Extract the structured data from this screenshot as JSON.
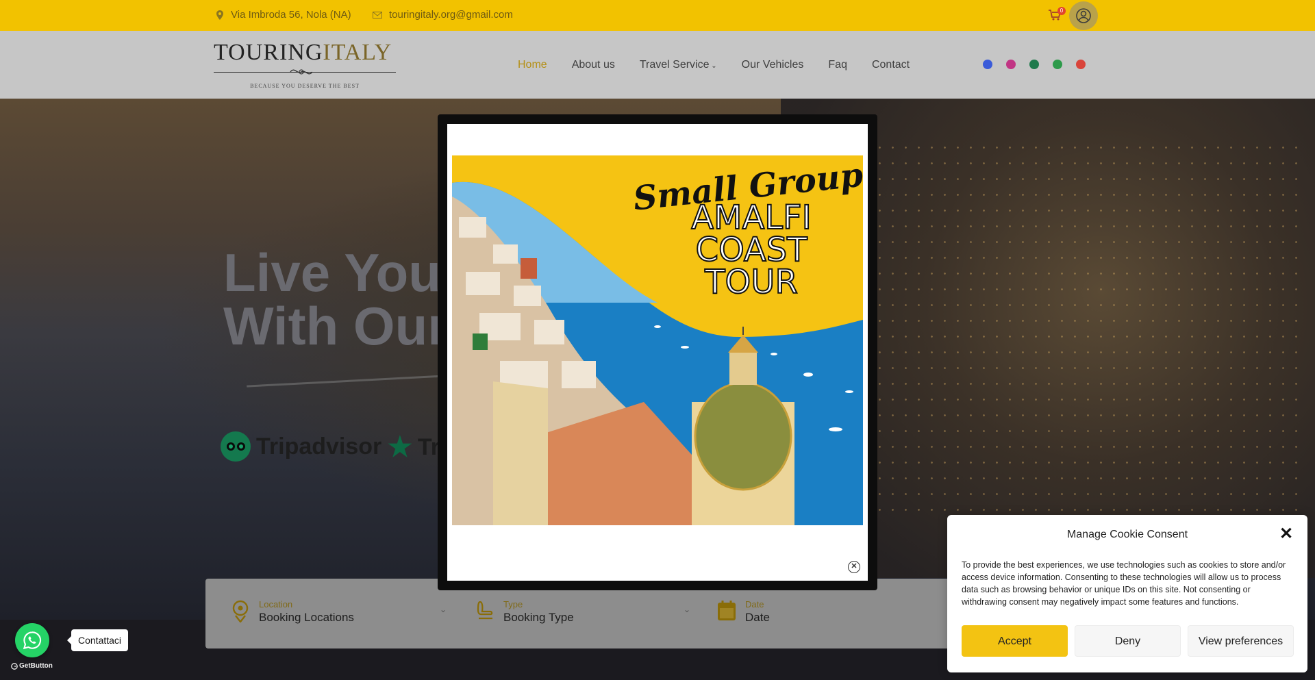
{
  "topbar": {
    "address": "Via Imbroda 56, Nola (NA)",
    "email": "touringitaly.org@gmail.com",
    "cart_count": "0"
  },
  "header": {
    "logo_main": "TOURING",
    "logo_accent": "ITALY",
    "logo_tagline": "BECAUSE YOU DESERVE THE BEST",
    "nav": [
      {
        "label": "Home"
      },
      {
        "label": "About us"
      },
      {
        "label": "Travel Service"
      },
      {
        "label": "Our Vehicles"
      },
      {
        "label": "Faq"
      },
      {
        "label": "Contact"
      }
    ],
    "social_colors": [
      "#3a5bd9",
      "#c13584",
      "#1f7a4c",
      "#2d9a4a",
      "#d9443a"
    ]
  },
  "hero": {
    "title_line1": "Live Your",
    "title_line2": "With Our",
    "tripadvisor": "Tripadvisor",
    "trustpilot": "Tru"
  },
  "booking": {
    "location_label": "Location",
    "location_value": "Booking Locations",
    "type_label": "Type",
    "type_value": "Booking Type",
    "date_label": "Date",
    "date_value": "Date"
  },
  "promo": {
    "line1": "Small Group",
    "line2": "AMALFI",
    "line3": "COAST",
    "line4": "TOUR"
  },
  "whatsapp": {
    "label": "Contattaci",
    "brand": "GetButton"
  },
  "cookie": {
    "title": "Manage Cookie Consent",
    "text": "To provide the best experiences, we use technologies such as cookies to store and/or access device information. Consenting to these technologies will allow us to process data such as browsing behavior or unique IDs on this site. Not consenting or withdrawing consent may negatively impact some features and functions.",
    "accept": "Accept",
    "deny": "Deny",
    "preferences": "View preferences"
  }
}
